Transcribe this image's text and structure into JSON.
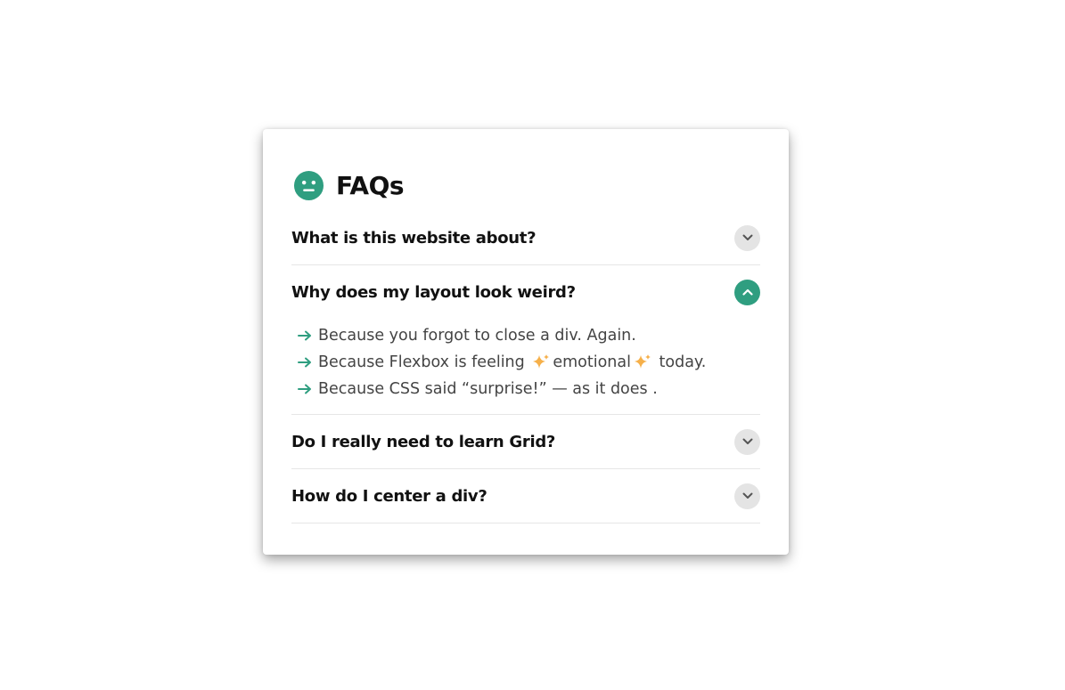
{
  "card": {
    "title": "FAQs",
    "title_icon": "neutral-face-icon"
  },
  "colors": {
    "accent": "#2f9e80",
    "toggle_closed_bg": "#e4e4e4",
    "answer_text": "#444444",
    "divider": "#e6e6e6"
  },
  "faqs": [
    {
      "question": "What is this website about?",
      "expanded": false,
      "toggle_icon": "chevron-down-icon"
    },
    {
      "question": "Why does my layout look weird?",
      "expanded": true,
      "toggle_icon": "chevron-up-icon",
      "answers": [
        {
          "bullet_icon": "arrow-right-icon",
          "parts": [
            "Because you forgot to close a div. Again."
          ]
        },
        {
          "bullet_icon": "arrow-right-icon",
          "parts": [
            "Because Flexbox is feeling ",
            "emotional",
            " today."
          ],
          "sparkle_icon": "sparkles-icon"
        },
        {
          "bullet_icon": "arrow-right-icon",
          "parts": [
            "Because CSS said “surprise!” — as it does ."
          ]
        }
      ]
    },
    {
      "question": "Do I really need to learn Grid?",
      "expanded": false,
      "toggle_icon": "chevron-down-icon"
    },
    {
      "question": "How do I center a div?",
      "expanded": false,
      "toggle_icon": "chevron-down-icon"
    }
  ]
}
